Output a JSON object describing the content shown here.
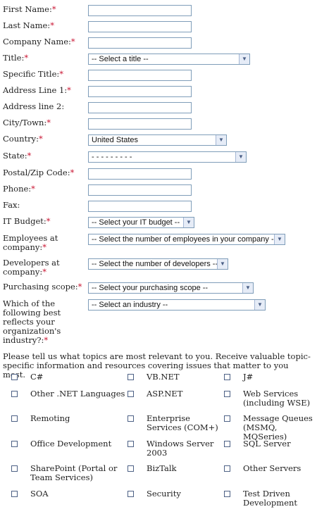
{
  "form": {
    "first_name": "First Name:",
    "last_name": "Last Name:",
    "company_name": "Company Name:",
    "title": "Title:",
    "title_select": "-- Select a title --",
    "specific_title": "Specific Title:",
    "address1": "Address Line 1:",
    "address2": "Address line 2:",
    "city": "City/Town:",
    "country": "Country:",
    "country_select": "United States",
    "state": "State:",
    "state_select": "- - - - - - - - -",
    "postal": "Postal/Zip Code:",
    "phone": "Phone:",
    "fax": "Fax:",
    "budget": "IT Budget:",
    "budget_select": "-- Select your IT budget --",
    "employees_l1": "Employees at",
    "employees_l2": "company:",
    "employees_select": "-- Select the number of employees in your company --",
    "developers_l1": "Developers at",
    "developers_l2": "company:",
    "developers_select": "-- Select the number of developers --",
    "scope": "Purchasing scope:",
    "scope_select": "-- Select your purchasing scope --",
    "industry_l1": "Which of the",
    "industry_l2": "following best",
    "industry_l3": "reflects your",
    "industry_l4": "organization's",
    "industry_l5": "industry?:",
    "industry_select": "-- Select an industry --",
    "required_mark": "*"
  },
  "topics": {
    "intro": "Please tell us what topics are most relevant to you. Receive valuable topic-specific information and resources covering issues that matter to you most.",
    "csharp": "C#",
    "vbnet": "VB.NET",
    "jsharp": "J#",
    "other_net": "Other .NET Languages",
    "aspnet": "ASP.NET",
    "web_services_l1": "Web Services",
    "web_services_l2": "(including WSE)",
    "remoting": "Remoting",
    "enterprise_l1": "Enterprise",
    "enterprise_l2": "Services (COM+)",
    "mq_l1": "Message Queues",
    "mq_l2": "(MSMQ, MQSeries)",
    "office": "Office Development",
    "ws2003_l1": "Windows Server",
    "ws2003_l2": "2003",
    "sqlserver": "SQL Server",
    "sharepoint_l1": "SharePoint (Portal or",
    "sharepoint_l2": "Team Services)",
    "biztalk": "BizTalk",
    "other_servers": "Other Servers",
    "soa": "SOA",
    "security": "Security",
    "tdd_l1": "Test Driven",
    "tdd_l2": "Development"
  },
  "icons": {
    "dropdown": "chevron-down-icon",
    "checkbox": "checkbox-icon"
  }
}
